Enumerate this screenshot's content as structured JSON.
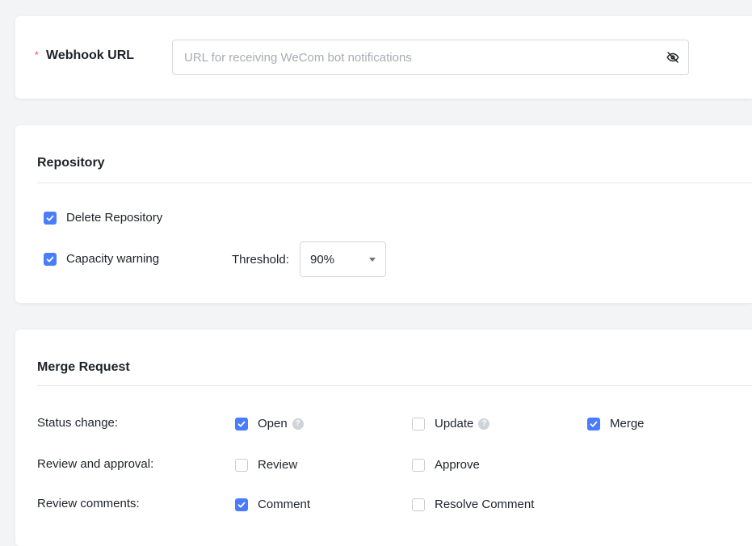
{
  "webhook": {
    "required_mark": "*",
    "label": "Webhook URL",
    "placeholder": "URL for receiving WeCom bot notifications",
    "value": ""
  },
  "repository": {
    "title": "Repository",
    "delete_repo": {
      "label": "Delete Repository",
      "checked": true
    },
    "capacity_warning": {
      "label": "Capacity warning",
      "checked": true
    },
    "threshold_label": "Threshold:",
    "threshold_value": "90%"
  },
  "merge_request": {
    "title": "Merge Request",
    "status_change": {
      "label": "Status change:",
      "open": {
        "label": "Open",
        "checked": true
      },
      "update": {
        "label": "Update",
        "checked": false
      },
      "merge": {
        "label": "Merge",
        "checked": true
      }
    },
    "review_approval": {
      "label": "Review and approval:",
      "review": {
        "label": "Review",
        "checked": false
      },
      "approve": {
        "label": "Approve",
        "checked": false
      }
    },
    "review_comments": {
      "label": "Review comments:",
      "comment": {
        "label": "Comment",
        "checked": true
      },
      "resolve_comment": {
        "label": "Resolve Comment",
        "checked": false
      }
    }
  },
  "colors": {
    "accent": "#4a7dfd",
    "required": "#e34d59"
  }
}
